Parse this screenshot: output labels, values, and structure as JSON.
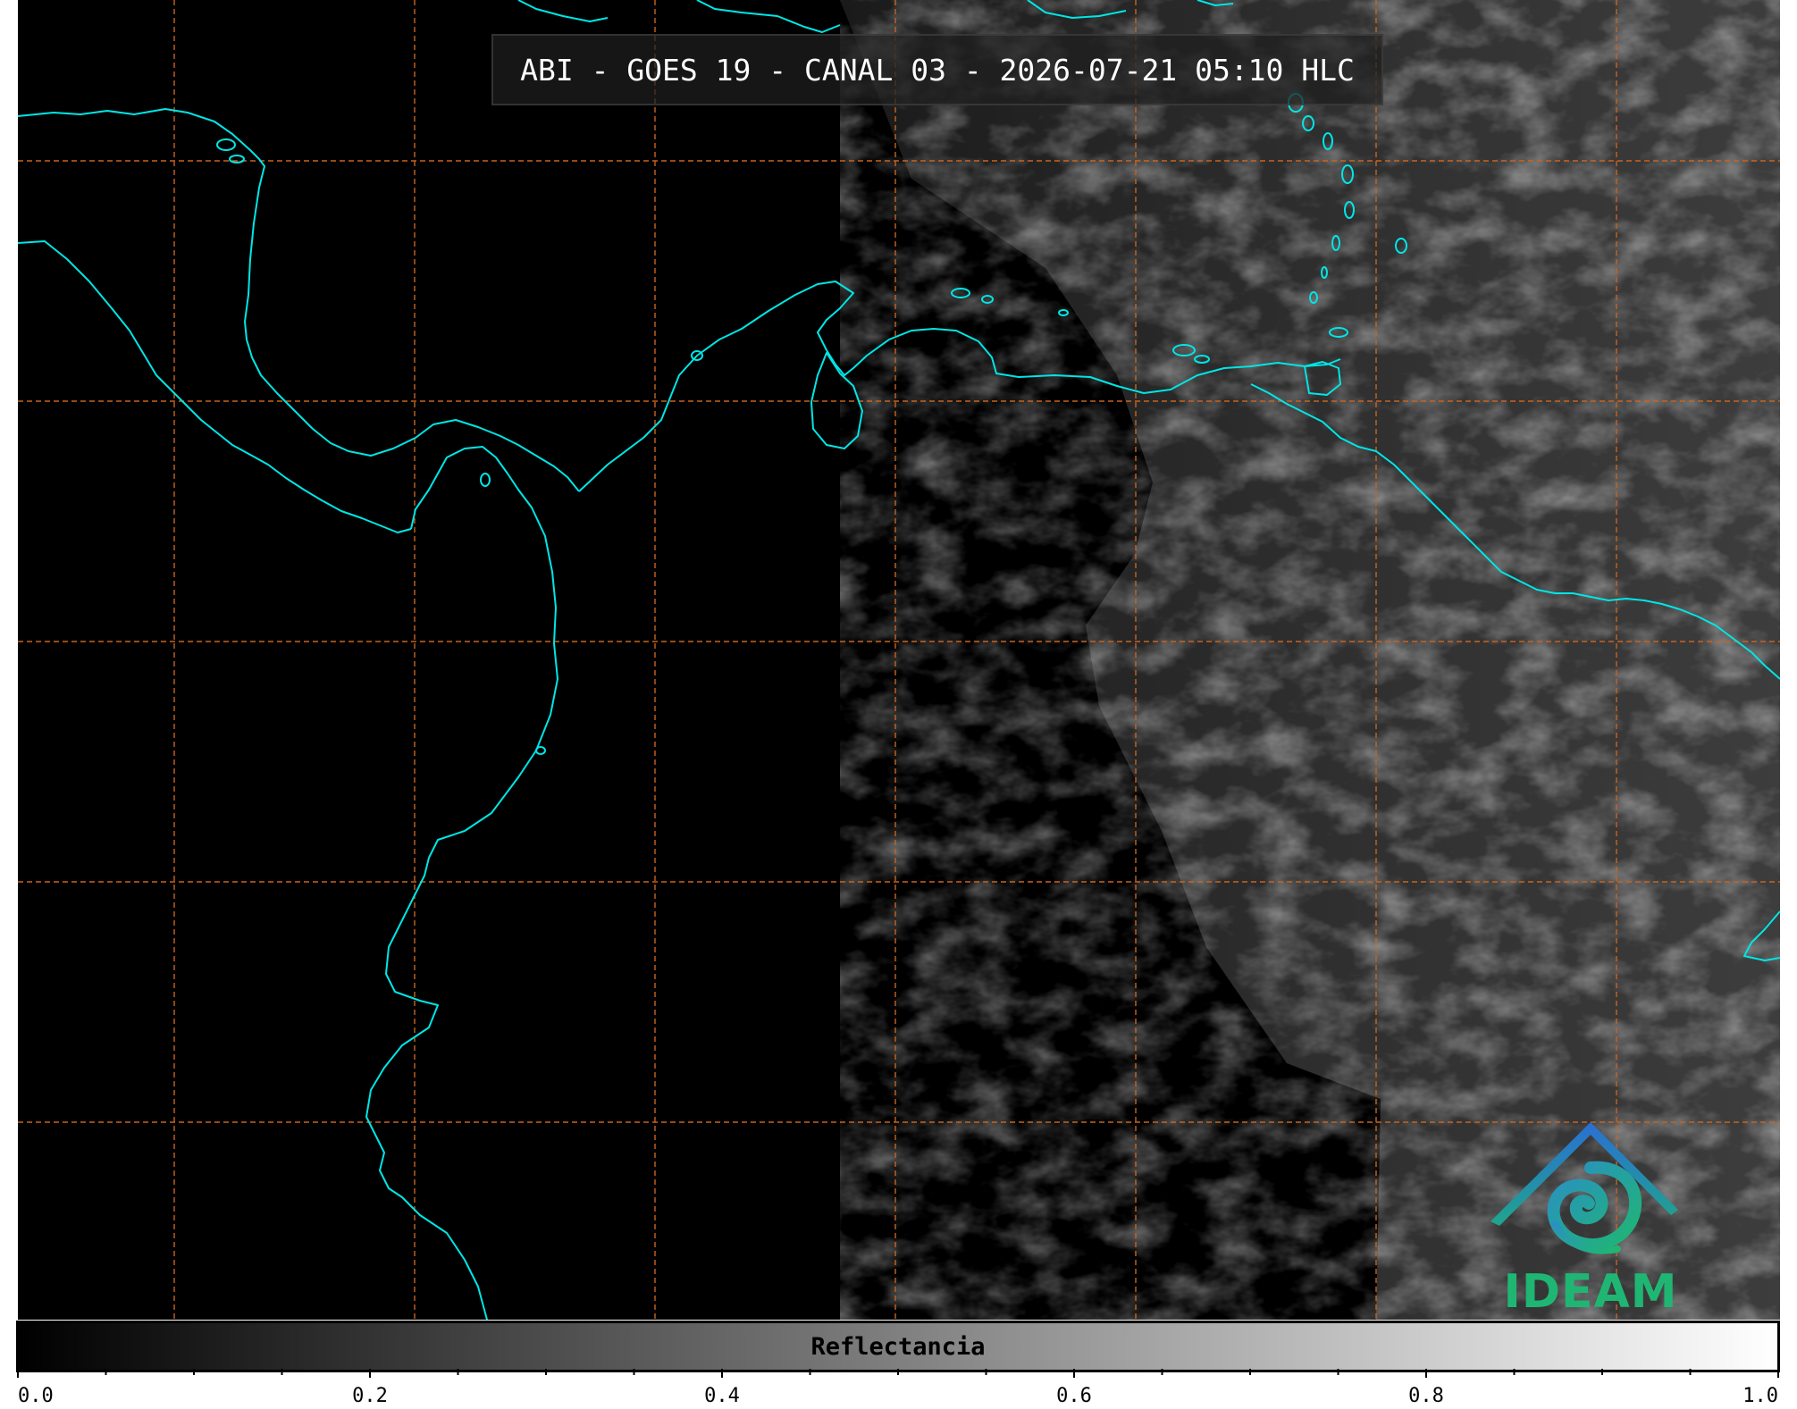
{
  "title": "ABI - GOES 19 - CANAL 03 - 2026-07-21 05:10 HLC",
  "logo": {
    "text": "IDEAM",
    "icon": "ideam-mountain-swirl-icon",
    "colors": {
      "mountain": "#2a7fd4",
      "swirl": "#1fa58c",
      "text": "#1fb673"
    }
  },
  "colorbar": {
    "label": "Reflectancia",
    "range": [
      0.0,
      1.0
    ],
    "major_ticks": [
      "0.0",
      "0.2",
      "0.4",
      "0.6",
      "0.8",
      "1.0"
    ],
    "minor_tick_count": 21
  },
  "map": {
    "coastline_color": "#00e6e6",
    "grid_color": "#c8641e",
    "grid_style": "dashed",
    "background": "#000000"
  }
}
